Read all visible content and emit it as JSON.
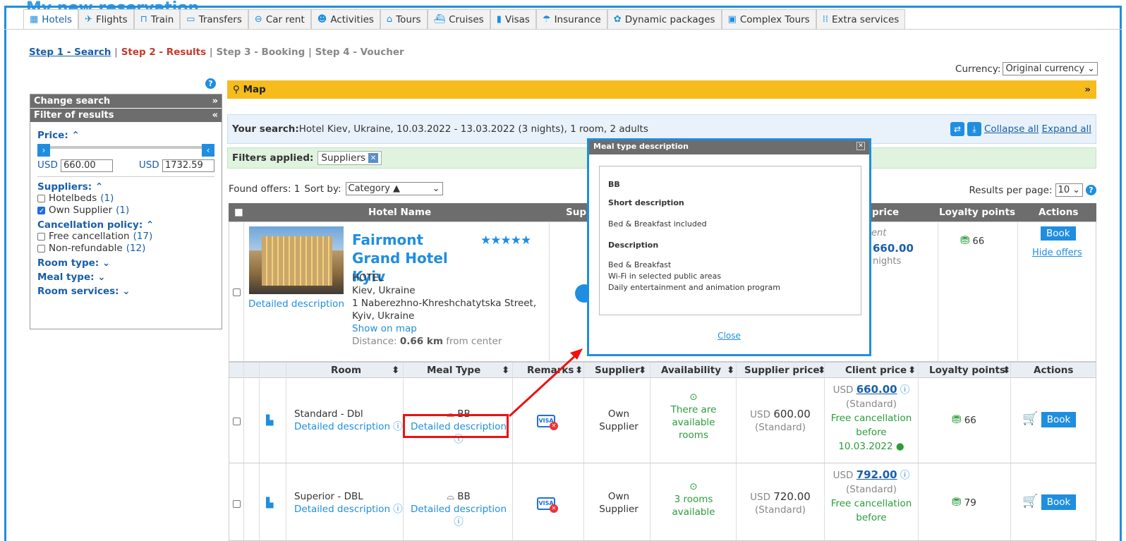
{
  "page_title": "My new reservation",
  "tabs": [
    {
      "label": "Hotels",
      "icon": "hotel-icon",
      "active": true
    },
    {
      "label": "Flights",
      "icon": "plane-icon"
    },
    {
      "label": "Train",
      "icon": "train-icon"
    },
    {
      "label": "Transfers",
      "icon": "bus-icon"
    },
    {
      "label": "Car rent",
      "icon": "car-icon"
    },
    {
      "label": "Activities",
      "icon": "activities-icon"
    },
    {
      "label": "Tours",
      "icon": "tours-icon"
    },
    {
      "label": "Cruises",
      "icon": "ship-icon"
    },
    {
      "label": "Visas",
      "icon": "passport-icon"
    },
    {
      "label": "Insurance",
      "icon": "umbrella-icon"
    },
    {
      "label": "Dynamic packages",
      "icon": "package-icon"
    },
    {
      "label": "Complex Tours",
      "icon": "complex-tours-icon"
    },
    {
      "label": "Extra services",
      "icon": "grid-icon"
    }
  ],
  "steps": {
    "s1": "Step 1 - Search",
    "sep1": " | ",
    "s2": "Step 2 - Results",
    "rest": " | Step 3 - Booking | Step 4 - Voucher"
  },
  "currency": {
    "label": "Currency:",
    "value": "Original currency"
  },
  "sidebar": {
    "change_search": "Change search",
    "filter_results": "Filter of results",
    "price_label": "Price:",
    "price_min_cur": "USD",
    "price_min": "660.00",
    "price_max_cur": "USD",
    "price_max": "1732.59",
    "suppliers_label": "Suppliers:",
    "suppliers": [
      {
        "label": "Hotelbeds",
        "count": "(1)",
        "checked": false
      },
      {
        "label": "Own Supplier",
        "count": "(1)",
        "checked": true
      }
    ],
    "cancel_label": "Cancellation policy:",
    "cancel": [
      {
        "label": "Free cancellation",
        "count": "(17)"
      },
      {
        "label": "Non-refundable",
        "count": "(12)"
      }
    ],
    "room_type": "Room type:",
    "meal_type": "Meal type:",
    "room_services": "Room services:"
  },
  "map_label": "Map",
  "search_summary": {
    "label": "Your search:",
    "text": " Hotel Kiev, Ukraine, 10.03.2022 - 13.03.2022 (3 nights), 1 room, 2 adults",
    "collapse": "Collapse all",
    "expand": "Expand all"
  },
  "filters_applied": {
    "label": "Filters applied:",
    "chip": "Suppliers"
  },
  "found": {
    "label": "Found offers: 1",
    "sort_label": "Sort by:",
    "sort_value": "Category ▲"
  },
  "results_per_page": {
    "label": "Results per page:",
    "value": "10"
  },
  "hotel_header": {
    "name": "Hotel Name",
    "supplier": "Supp",
    "price": "price",
    "loyalty": "Loyalty points",
    "actions": "Actions"
  },
  "hotel": {
    "name": "Fairmont Grand Hotel Kyiv",
    "type": "HOTEL",
    "city": "Kiev, Ukraine",
    "address": "1 Naberezhno-Khreshchatytska Street, Kyiv, Ukraine",
    "show_map": "Show on map",
    "distance_label": "Distance:",
    "distance_value": "0.66 km",
    "distance_suffix": " from center",
    "detailed": "Detailed description",
    "price_from": "ent",
    "price_value": "660.00",
    "price_nights": "nights",
    "loyalty": "66",
    "book": "Book",
    "hide_offers": "Hide offers"
  },
  "room_header": {
    "room": "Room",
    "meal": "Meal Type",
    "remarks": "Remarks",
    "supplier": "Supplier",
    "availability": "Availability",
    "supplier_price": "Supplier price",
    "client_price": "Client price",
    "loyalty": "Loyalty points",
    "actions": "Actions"
  },
  "rooms": [
    {
      "name": "Standard - Dbl",
      "detail": "Detailed description",
      "meal": "BB",
      "meal_detail": "Detailed description",
      "supplier": "Own Supplier",
      "availability": "There are available rooms",
      "sp_cur": "USD",
      "sp_value": "600.00",
      "sp_note": "(Standard)",
      "cp_cur": "USD",
      "cp_value": "660.00",
      "cp_note": "(Standard)",
      "cancel": "Free cancellation before 10.03.2022",
      "loyalty": "66",
      "book": "Book"
    },
    {
      "name": "Superior - DBL",
      "detail": "Detailed description",
      "meal": "BB",
      "meal_detail": "Detailed description",
      "supplier": "Own Supplier",
      "availability": "3 rooms available",
      "sp_cur": "USD",
      "sp_value": "720.00",
      "sp_note": "(Standard)",
      "cp_cur": "USD",
      "cp_value": "792.00",
      "cp_note": "(Standard)",
      "cancel": "Free cancellation before",
      "loyalty": "79",
      "book": "Book"
    }
  ],
  "modal": {
    "title": "Meal type description",
    "code": "BB",
    "short_label": "Short description",
    "short_text": "Bed & Breakfast included",
    "desc_label": "Description",
    "desc_lines": [
      "Bed & Breakfast",
      "Wi-Fi in selected public areas",
      "Daily entertainment and animation program"
    ],
    "close": "Close"
  },
  "colors": {
    "accent": "#1f8ee0",
    "highlight": "#e11111",
    "map_bar": "#f5bc1c"
  }
}
